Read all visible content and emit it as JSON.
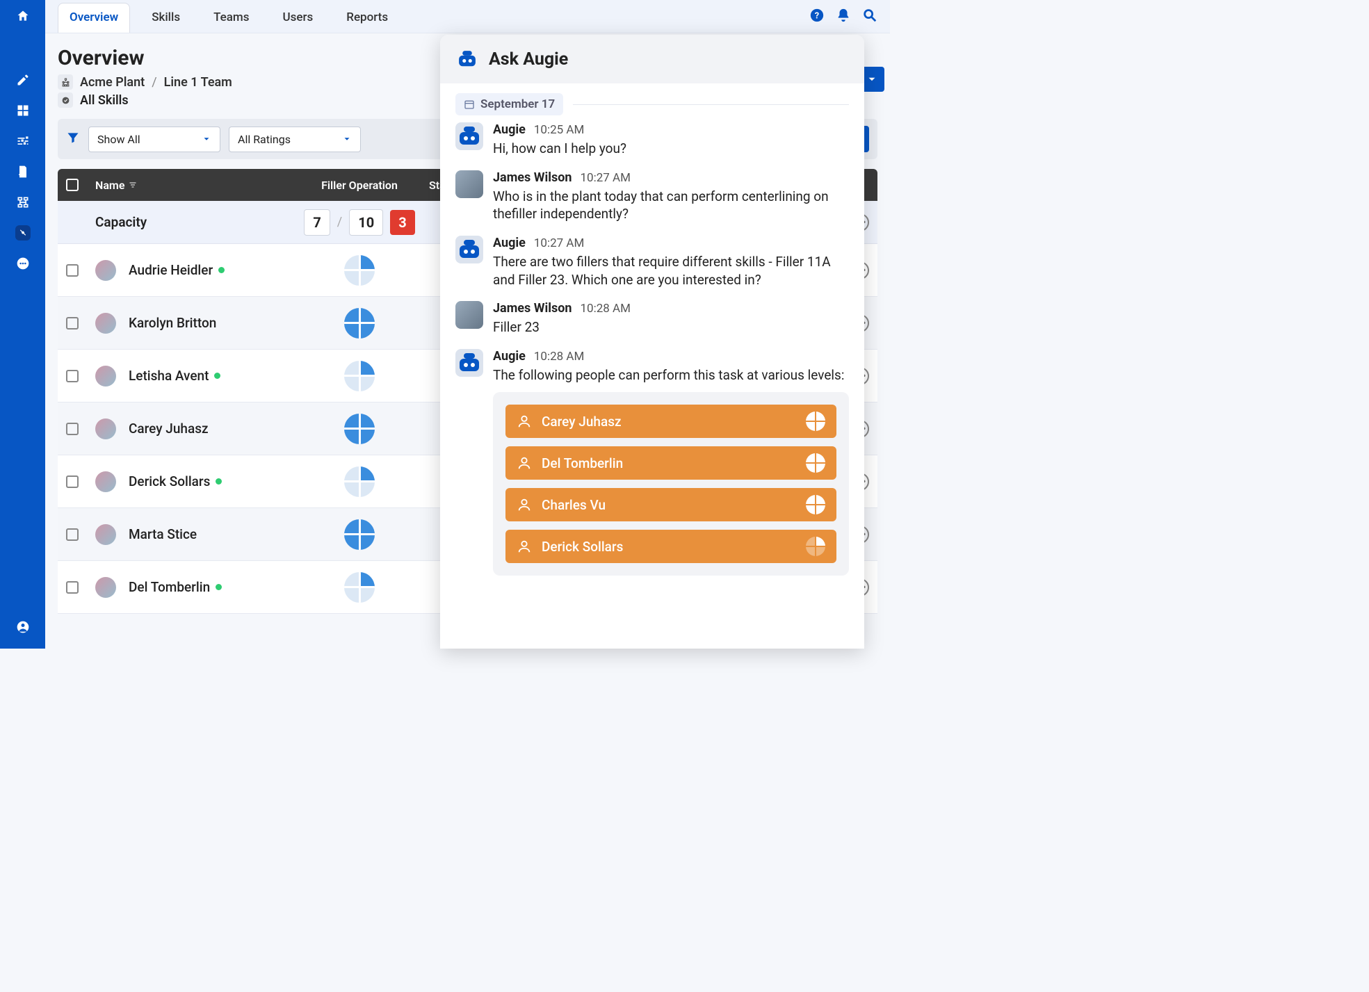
{
  "nav": {
    "tabs": [
      "Overview",
      "Skills",
      "Teams",
      "Users",
      "Reports"
    ],
    "active": 0
  },
  "page": {
    "title": "Overview",
    "crumb1": "Acme Plant",
    "crumb2": "Line 1 Team",
    "all_skills": "All Skills"
  },
  "filters": {
    "show": "Show All",
    "ratings": "All Ratings"
  },
  "table": {
    "col_name": "Name",
    "col_op": "Filler Operation",
    "col_startup": "Startup",
    "capacity_label": "Capacity",
    "capacity": {
      "have": "7",
      "of": "10",
      "gap": "3",
      "startup_dash": "-"
    },
    "rows": [
      {
        "name": "Audrie Heidler",
        "online": true,
        "pie": "q1"
      },
      {
        "name": "Karolyn Britton",
        "online": false,
        "pie": "q4"
      },
      {
        "name": "Letisha Avent",
        "online": true,
        "pie": "q1"
      },
      {
        "name": "Carey Juhasz",
        "online": false,
        "pie": "q4"
      },
      {
        "name": "Derick Sollars",
        "online": true,
        "pie": "q1"
      },
      {
        "name": "Marta Stice",
        "online": false,
        "pie": "q4"
      },
      {
        "name": "Del Tomberlin",
        "online": true,
        "pie": "q1"
      }
    ]
  },
  "chat": {
    "title": "Ask Augie",
    "date": "September 17",
    "messages": [
      {
        "from": "Augie",
        "time": "10:25 AM",
        "bot": true,
        "text": "Hi, how can I help you?"
      },
      {
        "from": "James Wilson",
        "time": "10:27 AM",
        "bot": false,
        "text": "Who is in the plant today that can perform centerlining on thefiller independently?"
      },
      {
        "from": "Augie",
        "time": "10:27 AM",
        "bot": true,
        "text": "There are two fillers that require different skills - Filler 11A and Filler 23. Which one are you interested in?"
      },
      {
        "from": "James Wilson",
        "time": "10:28 AM",
        "bot": false,
        "text": "Filler 23"
      },
      {
        "from": "Augie",
        "time": "10:28 AM",
        "bot": true,
        "text": "The following people can perform this task at various levels:",
        "results": [
          {
            "name": "Carey Juhasz",
            "level": "full"
          },
          {
            "name": "Del Tomberlin",
            "level": "full"
          },
          {
            "name": "Charles Vu",
            "level": "full"
          },
          {
            "name": "Derick Sollars",
            "level": "q1w"
          }
        ]
      }
    ]
  }
}
